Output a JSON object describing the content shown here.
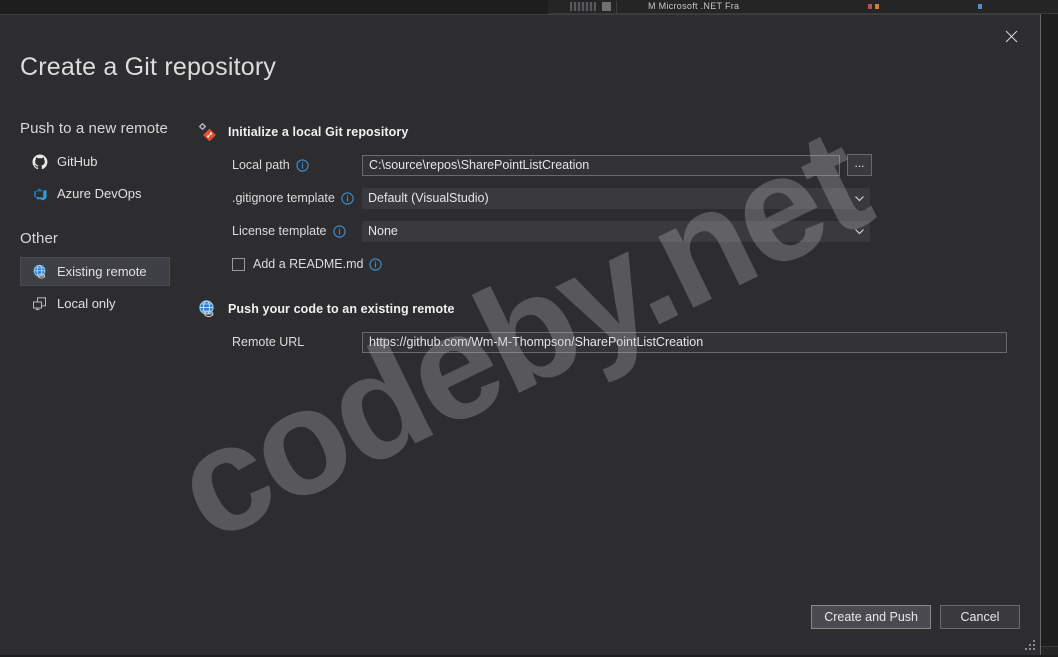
{
  "background": {
    "toolbar_hint": "M      Microsoft .NET Fra"
  },
  "dialog": {
    "title": "Create a Git repository",
    "close_label": "✕"
  },
  "sidebar": {
    "sections": [
      {
        "heading": "Push to a new remote",
        "items": [
          {
            "label": "GitHub",
            "icon": "github-icon",
            "selected": false
          },
          {
            "label": "Azure DevOps",
            "icon": "azure-devops-icon",
            "selected": false
          }
        ]
      },
      {
        "heading": "Other",
        "items": [
          {
            "label": "Existing remote",
            "icon": "globe-icon",
            "selected": true
          },
          {
            "label": "Local only",
            "icon": "monitor-icon",
            "selected": false
          }
        ]
      }
    ]
  },
  "local_repo_section": {
    "title": "Initialize a local Git repository",
    "icon": "git-repository-icon",
    "local_path": {
      "label": "Local path",
      "value": "C:\\source\\repos\\SharePointListCreation",
      "placeholder": "",
      "info_icon": "info-icon",
      "browse_label": "..."
    },
    "gitignore": {
      "label": ".gitignore template",
      "value": "Default (VisualStudio)",
      "info_icon": "info-icon"
    },
    "license": {
      "label": "License template",
      "value": "None",
      "info_icon": "info-icon"
    },
    "readme": {
      "label": "Add a README.md",
      "checked": false,
      "info_icon": "info-icon"
    }
  },
  "remote_section": {
    "title": "Push your code to an existing remote",
    "icon": "globe-icon",
    "remote_url": {
      "label": "Remote URL",
      "value": "https://github.com/Wm-M-Thompson/SharePointListCreation",
      "placeholder": ""
    }
  },
  "footer": {
    "create_and_push_label": "Create and Push",
    "cancel_label": "Cancel"
  },
  "watermark": {
    "text": "codeby.net"
  },
  "colors": {
    "dialog_background": "#2d2d30",
    "app_background": "#1e1e1e",
    "input_background": "#333337",
    "selected_item": "#3f3f46",
    "accent_blue": "#3f8fd0",
    "git_red": "#e84d31"
  }
}
